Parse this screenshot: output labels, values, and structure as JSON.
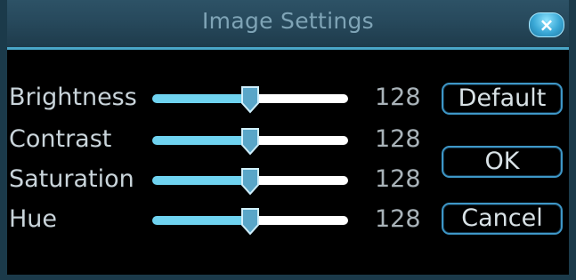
{
  "window": {
    "title": "Image Settings"
  },
  "close": {
    "icon": "close-icon",
    "glyph": "×"
  },
  "sliders": [
    {
      "label": "Brightness",
      "value": "128",
      "level": 0.5
    },
    {
      "label": "Contrast",
      "value": "128",
      "level": 0.5
    },
    {
      "label": "Saturation",
      "value": "128",
      "level": 0.5
    },
    {
      "label": "Hue",
      "value": "128",
      "level": 0.5
    }
  ],
  "buttons": {
    "default": "Default",
    "ok": "OK",
    "cancel": "Cancel"
  },
  "colors": {
    "accent": "#4aa7c9",
    "slider_fill": "#6fd3f0",
    "title_text": "#7fa4b6"
  }
}
